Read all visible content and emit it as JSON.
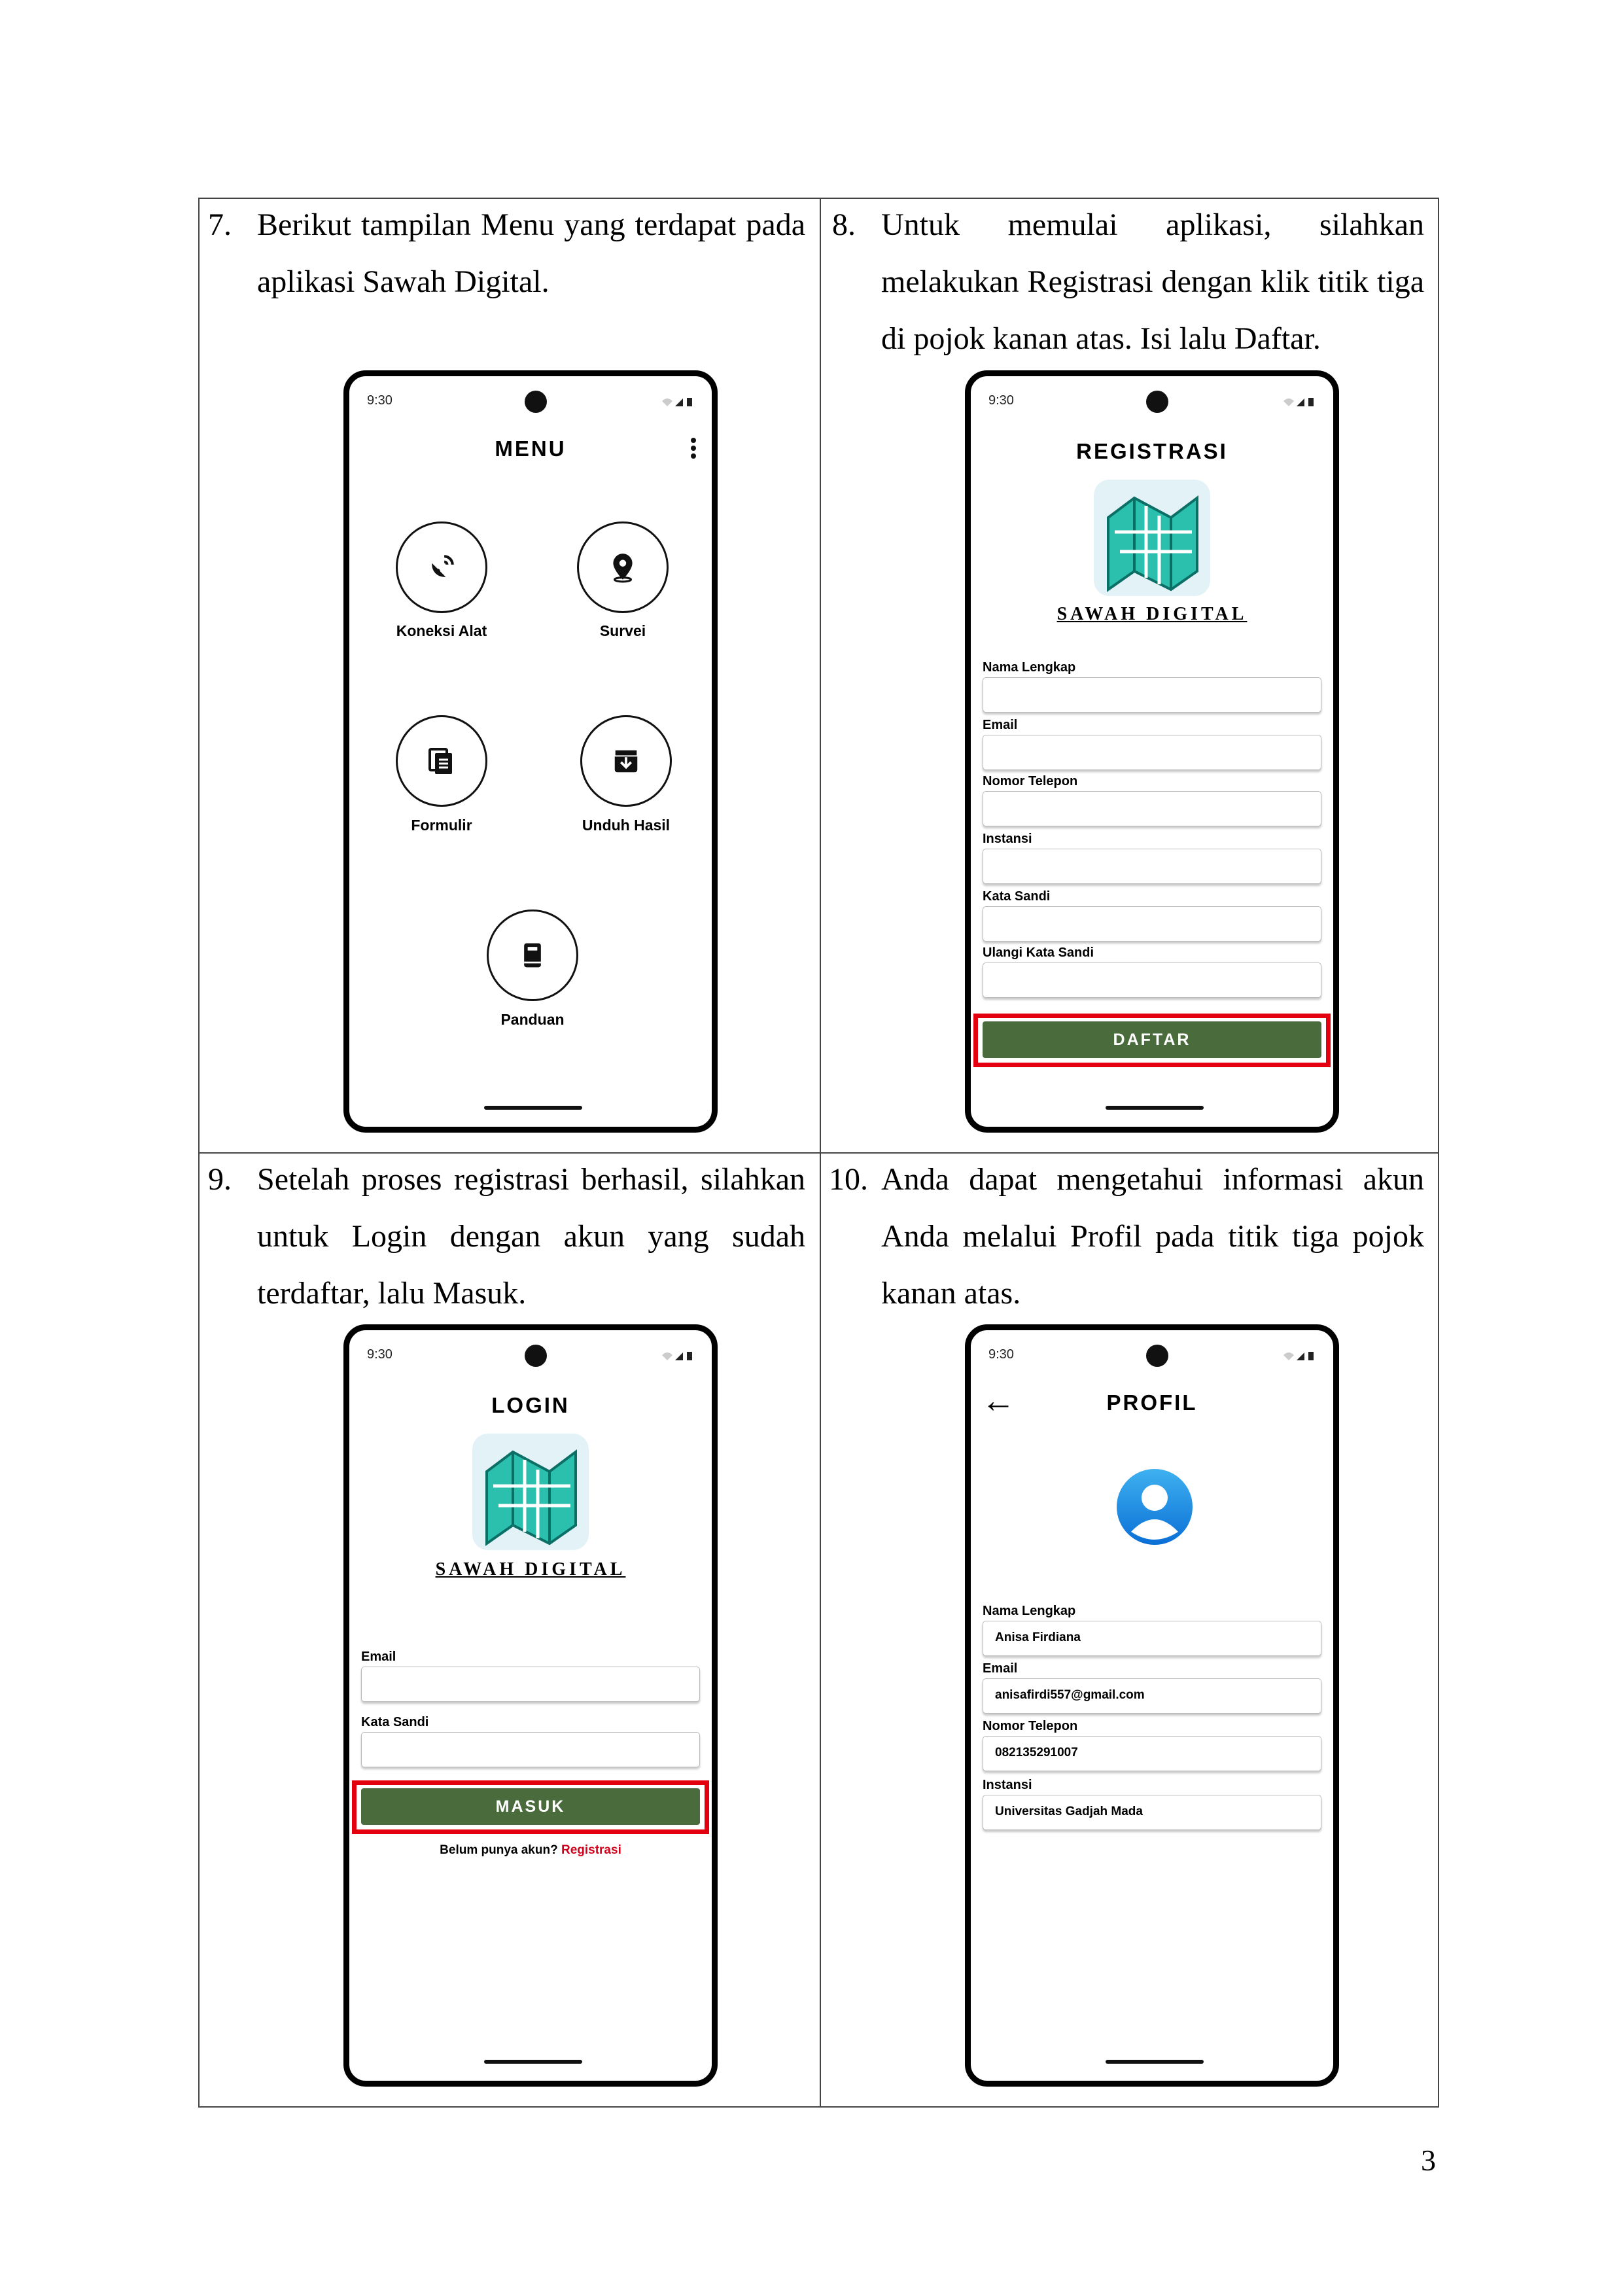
{
  "cells": [
    {
      "num": "7.",
      "text": "Berikut tampilan Menu yang terdapat pada aplikasi Sawah Digital."
    },
    {
      "num": "8.",
      "text": "Untuk memulai aplikasi, silahkan melakukan Registrasi dengan klik titik tiga di pojok kanan atas. Isi lalu Daftar."
    },
    {
      "num": "9.",
      "text": "Setelah proses registrasi berhasil, silahkan untuk Login dengan akun yang sudah terdaftar, lalu Masuk."
    },
    {
      "num": "10.",
      "text": "Anda dapat mengetahui informasi akun Anda melalui Profil pada titik tiga pojok kanan atas."
    }
  ],
  "status_time": "9:30",
  "menu_screen": {
    "title": "MENU",
    "items": [
      {
        "label": "Koneksi Alat",
        "icon": "satellite-dish-icon"
      },
      {
        "label": "Survei",
        "icon": "map-pin-icon"
      },
      {
        "label": "Formulir",
        "icon": "documents-icon"
      },
      {
        "label": "Unduh Hasil",
        "icon": "download-box-icon"
      },
      {
        "label": "Panduan",
        "icon": "book-icon"
      }
    ]
  },
  "register_screen": {
    "title": "REGISTRASI",
    "brand": "SAWAH DIGITAL",
    "fields": [
      "Nama Lengkap",
      "Email",
      "Nomor Telepon",
      "Instansi",
      "Kata Sandi",
      "Ulangi Kata Sandi"
    ],
    "button": "DAFTAR"
  },
  "login_screen": {
    "title": "LOGIN",
    "brand": "SAWAH DIGITAL",
    "fields": [
      "Email",
      "Kata Sandi"
    ],
    "button": "MASUK",
    "prompt": "Belum punya akun?",
    "link": "Registrasi"
  },
  "profile_screen": {
    "title": "PROFIL",
    "back": "←",
    "fields": [
      {
        "label": "Nama Lengkap",
        "value": "Anisa Firdiana"
      },
      {
        "label": "Email",
        "value": "anisafirdi557@gmail.com"
      },
      {
        "label": "Nomor Telepon",
        "value": "082135291007"
      },
      {
        "label": "Instansi",
        "value": "Universitas Gadjah Mada"
      }
    ]
  },
  "page_number": "3",
  "colors": {
    "button_green": "#4a6b3c",
    "highlight_red": "#e3000f",
    "logo_teal": "#2bbfae",
    "link_red": "#d0021b"
  }
}
